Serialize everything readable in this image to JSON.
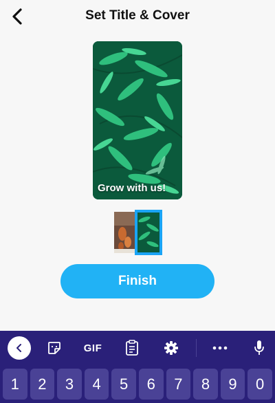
{
  "header": {
    "title": "Set Title & Cover"
  },
  "cover": {
    "overlay_text": "Grow with us!"
  },
  "thumbnails": [
    {
      "name": "thumbnail-1",
      "selected": false
    },
    {
      "name": "thumbnail-2",
      "selected": true
    }
  ],
  "finish_label": "Finish",
  "keyboard": {
    "toolbar": {
      "back_icon": "chevron-left-icon",
      "sticker_icon": "sticker-icon",
      "gif_label": "GIF",
      "clipboard_icon": "clipboard-icon",
      "settings_icon": "gear-icon",
      "more_icon": "ellipsis-icon",
      "mic_icon": "microphone-icon"
    },
    "number_keys": [
      "1",
      "2",
      "3",
      "4",
      "5",
      "6",
      "7",
      "8",
      "9",
      "0"
    ]
  },
  "colors": {
    "accent": "#21b2f5",
    "selection_border": "#1aa4f5",
    "keyboard_bg": "#2a2079",
    "key_bg": "#4a4296"
  }
}
